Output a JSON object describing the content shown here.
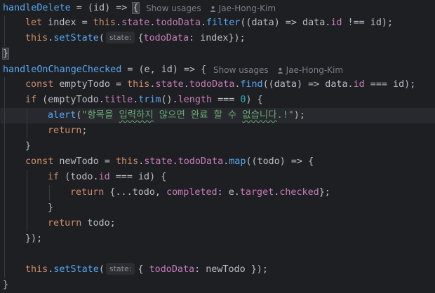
{
  "lens": {
    "show_usages": "Show usages",
    "author": "Jae-Hong-Kim"
  },
  "hints": {
    "state": "state:"
  },
  "code": {
    "l1_name": "handleDelete",
    "l1_rest": " = (id) => ",
    "l1_brace": "{",
    "l2_let": "let",
    "l2_a": " index = ",
    "l2_this": "this",
    "l2_dot1": ".",
    "l2_state": "state",
    "l2_dot2": ".",
    "l2_todoData": "todoData",
    "l2_dot3": ".",
    "l2_filter": "filter",
    "l2_b": "((data) => data.",
    "l2_id": "id",
    "l2_c": " !== id);",
    "l3_this": "this",
    "l3_dot": ".",
    "l3_setState": "setState",
    "l3_paren": "(",
    "l3_b": "{",
    "l3_prop": "todoData",
    "l3_c": ": index});",
    "l4_close": "}",
    "l5_name": "handleOnChangeChecked",
    "l5_rest": " = (e, id) => {",
    "l6_const": "const",
    "l6_a": " emptyTodo = ",
    "l6_this": "this",
    "l6_dot1": ".",
    "l6_state": "state",
    "l6_dot2": ".",
    "l6_todoData": "todoData",
    "l6_dot3": ".",
    "l6_find": "find",
    "l6_b": "((data) => data.",
    "l6_id": "id",
    "l6_c": " === id);",
    "l7_if": "if",
    "l7_a": " (emptyTodo.",
    "l7_title": "title",
    "l7_dot": ".",
    "l7_trim": "trim",
    "l7_b": "().",
    "l7_length": "length",
    "l7_c": " === ",
    "l7_zero": "0",
    "l7_d": ") {",
    "l8_alert": "alert",
    "l8_paren": "(",
    "l8_str1": "\"항목을 ",
    "l8_str2": "입력하지",
    "l8_str3": " 않으면 완료 할 수 ",
    "l8_str4": "없습니다",
    "l8_str5": ".!\"",
    "l8_end": ");",
    "l9_return": "return",
    "l9_semi": ";",
    "l10_close": "}",
    "l11_const": "const",
    "l11_a": " newTodo = ",
    "l11_this": "this",
    "l11_dot1": ".",
    "l11_state": "state",
    "l11_dot2": ".",
    "l11_todoData": "todoData",
    "l11_dot3": ".",
    "l11_map": "map",
    "l11_b": "((todo) => {",
    "l12_if": "if",
    "l12_a": " (todo.",
    "l12_id": "id",
    "l12_b": " === id) {",
    "l13_return": "return",
    "l13_a": " {...todo, ",
    "l13_completed": "completed",
    "l13_b": ": e.",
    "l13_target": "target",
    "l13_dot": ".",
    "l13_checked": "checked",
    "l13_c": "};",
    "l14_close": "}",
    "l15_return": "return",
    "l15_a": " todo;",
    "l16_close": "});",
    "l18_this": "this",
    "l18_dot": ".",
    "l18_setState": "setState",
    "l18_paren": "(",
    "l18_b": "{ ",
    "l18_prop": "todoData",
    "l18_c": ": newTodo });",
    "l19_close": "}"
  },
  "colors": {
    "background": "#1e1f22",
    "default_text": "#bcbec4",
    "function": "#56a8f5",
    "keyword": "#cf8e6d",
    "property": "#c77dbb",
    "number": "#2aacb8",
    "string": "#6aab73"
  }
}
